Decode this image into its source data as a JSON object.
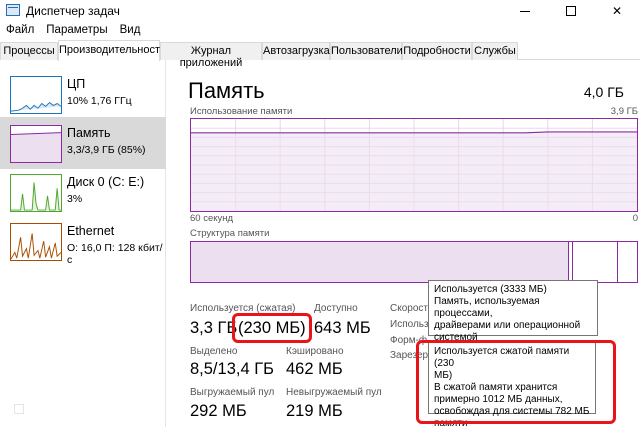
{
  "window": {
    "title": "Диспетчер задач",
    "min_label": "—",
    "max_label": "☐",
    "close_label": "✕"
  },
  "menu": [
    "Файл",
    "Параметры",
    "Вид"
  ],
  "tabs": [
    {
      "label": "Процессы"
    },
    {
      "label": "Производительность",
      "active": true
    },
    {
      "label": "Журнал приложений"
    },
    {
      "label": "Автозагрузка"
    },
    {
      "label": "Пользователи"
    },
    {
      "label": "Подробности"
    },
    {
      "label": "Службы"
    }
  ],
  "sidebar": {
    "items": [
      {
        "label": "ЦП",
        "sub": "10% 1,76 ГГц",
        "color": "#1b75bc"
      },
      {
        "label": "Память",
        "sub": "3,3/3,9 ГБ (85%)",
        "color": "#8b2aa3",
        "selected": true
      },
      {
        "label": "Диск 0 (C: E:)",
        "sub": "3%",
        "color": "#4ea72c"
      },
      {
        "label": "Ethernet",
        "sub": "О: 16,0 П: 128 кбит/с",
        "color": "#a74f01"
      }
    ]
  },
  "main": {
    "title": "Память",
    "total": "4,0 ГБ",
    "usage_graph_label": "Использование памяти",
    "usage_graph_max": "3,9 ГБ",
    "time_span": "60 секунд",
    "zero": "0",
    "structure_label": "Структура памяти",
    "usage_fraction": 0.85
  },
  "stats": {
    "in_use_label": "Используется (сжатая)",
    "in_use_value": "3,3 ГБ",
    "compressed_value": "(230 МБ)",
    "available_label": "Доступно",
    "available_value": "643 МБ",
    "committed_label": "Выделено",
    "committed_value": "8,5/13,4 ГБ",
    "cached_label": "Кэшировано",
    "cached_value": "462 МБ",
    "paged_label": "Выгружаемый пул",
    "paged_value": "292 МБ",
    "nonpaged_label": "Невыгружаемый пул",
    "nonpaged_value": "219 МБ",
    "speed_label": "Скорост",
    "slots_label": "Использ",
    "form_label": "Форм-ф",
    "reserved_label": "Зарезер"
  },
  "tooltip1": {
    "line1": "Используется (3333 МБ)",
    "line2": "Память, используемая процессами,",
    "line3": "драйверами или операционной",
    "line4": "системой"
  },
  "tooltip2": {
    "line1": "Используется сжатой памяти (230",
    "line2": "МБ)",
    "line3": "В сжатой памяти хранится",
    "line4": "примерно 1012 МБ данных,",
    "line5": "освобождая для системы 782 МБ",
    "line6": "памяти"
  },
  "colors": {
    "memory": "#8b2aa3",
    "highlight": "#e8131b"
  }
}
